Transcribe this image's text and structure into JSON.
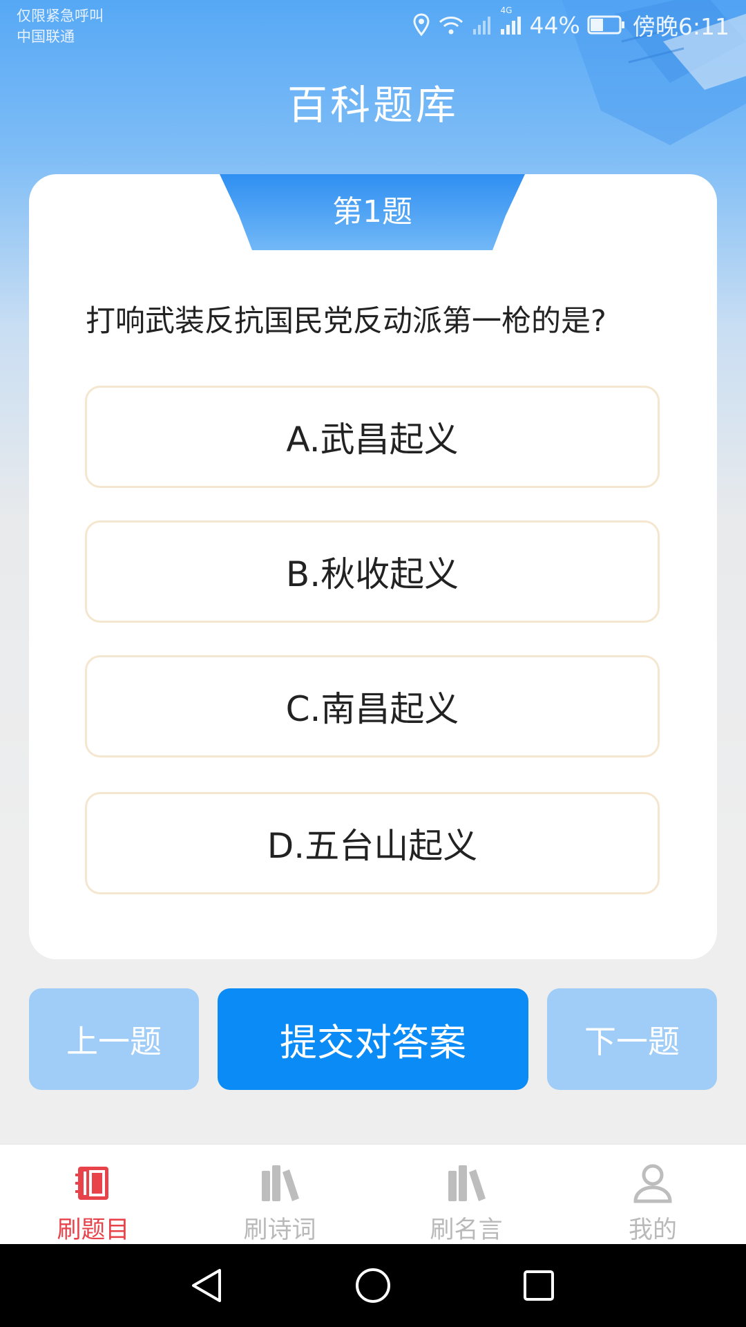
{
  "status_bar": {
    "carrier_line1": "仅限紧急呼叫",
    "carrier_line2": "中国联通",
    "network_label": "4G",
    "battery_percent": "44%",
    "time": "傍晚6:11"
  },
  "header": {
    "title": "百科题库"
  },
  "quiz": {
    "number_label": "第1题",
    "question": "打响武装反抗国民党反动派第一枪的是?",
    "options": [
      {
        "label": "A.武昌起义"
      },
      {
        "label": "B.秋收起义"
      },
      {
        "label": "C.南昌起义"
      },
      {
        "label": "D.五台山起义"
      }
    ]
  },
  "actions": {
    "prev_label": "上一题",
    "submit_label": "提交对答案",
    "next_label": "下一题"
  },
  "tab_bar": {
    "items": [
      {
        "label": "刷题目",
        "icon": "notebook-icon",
        "active": true
      },
      {
        "label": "刷诗词",
        "icon": "books-icon",
        "active": false
      },
      {
        "label": "刷名言",
        "icon": "books-icon",
        "active": false
      },
      {
        "label": "我的",
        "icon": "user-icon",
        "active": false
      }
    ]
  },
  "colors": {
    "accent": "#0b8bf5",
    "accent_light": "#9fcdf7",
    "active_tab": "#e8434b",
    "inactive_tab": "#b9b9b9",
    "option_border": "#f5e7cf"
  }
}
